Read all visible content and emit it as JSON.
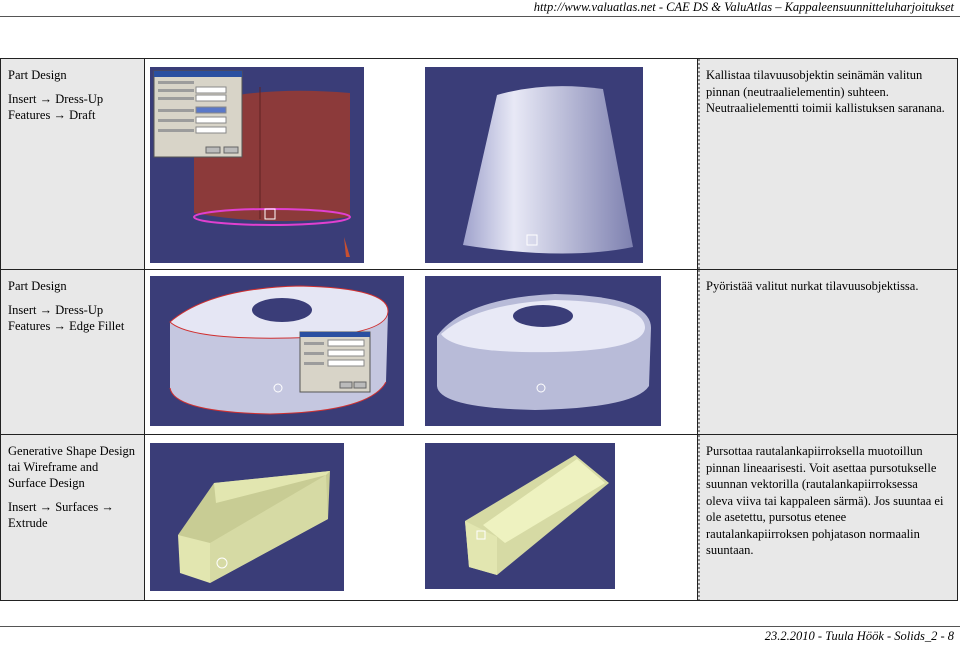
{
  "header": {
    "text": "http://www.valuatlas.net - CAE DS & ValuAtlas – Kappaleensuunnitteluharjoitukset"
  },
  "rows": [
    {
      "left": {
        "line1": "Part Design",
        "line2": "Insert → Dress-Up Features → Draft"
      },
      "right": "Kallistaa tilavuusobjektin seinämän valitun pinnan (neutraalielementin) suhteen. Neutraalielementti toimii kallistuksen saranana."
    },
    {
      "left": {
        "line1": "Part Design",
        "line2": "Insert → Dress-Up Features → Edge Fillet"
      },
      "right": "Pyöristää valitut nurkat tilavuusobjektissa."
    },
    {
      "left": {
        "line1": "Generative Shape Design tai Wireframe and Surface Design",
        "line2": "Insert → Surfaces → Extrude"
      },
      "right": "Pursottaa rautalankapiirroksella muotoillun pinnan lineaarisesti. Voit asettaa pursotukselle suunnan vektorilla (rautalankapiirroksessa oleva viiva tai kappaleen särmä). Jos suuntaa ei ole asetettu, pursotus etenee rautalankapiirroksen pohjatason normaalin suuntaan."
    }
  ],
  "footer": {
    "text": "23.2.2010 - Tuula Höök - Solids_2 - 8"
  },
  "colors": {
    "viewport_bg": "#3a3d78",
    "part_grey": "#c5c7e0",
    "part_red": "#8c3a3a",
    "extrude_yellow": "#e2e6b0",
    "cell_grey": "#e8e8e8"
  },
  "images": [
    {
      "name": "draft-dialog-image",
      "icon": "draft-cylinder"
    },
    {
      "name": "draft-result-image",
      "icon": "tapered-cylinder"
    },
    {
      "name": "fillet-dialog-image",
      "icon": "oval-block-with-hole"
    },
    {
      "name": "fillet-result-image",
      "icon": "filleted-oval-block"
    },
    {
      "name": "extrude-open-image",
      "icon": "open-extrude-surface"
    },
    {
      "name": "extrude-wedge-image",
      "icon": "wedge-extrude-surface"
    }
  ]
}
